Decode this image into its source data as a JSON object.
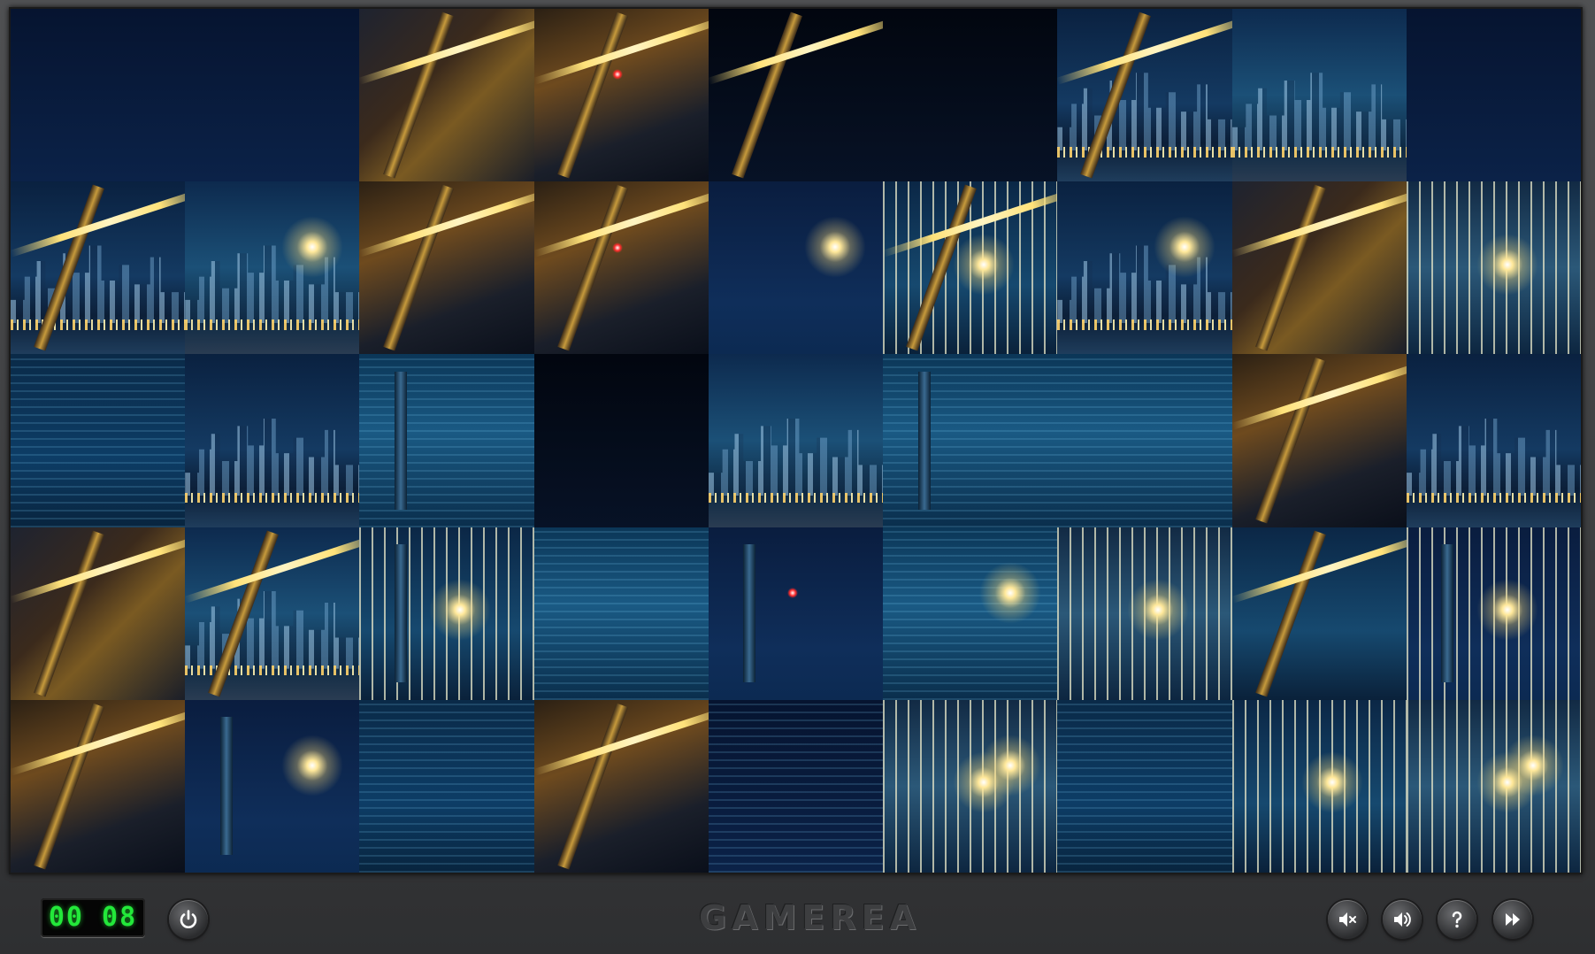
{
  "game": {
    "timer": "00 08",
    "logo": "GAMEREA"
  },
  "controls": {
    "power_icon": "power-icon",
    "mute_icon": "mute-icon",
    "volume_icon": "volume-icon",
    "help_icon": "help-icon",
    "skip_icon": "fast-forward-icon"
  },
  "puzzle": {
    "columns": 9,
    "rows": 5,
    "tiles": [
      "sky",
      "sky",
      "bridge-lit",
      "bridge-red",
      "bridge-dark",
      "sky-dark",
      "bridge-city",
      "city-night",
      "sky",
      "city-bridge",
      "city-lights",
      "bridge-girder",
      "bridge-red2",
      "light-star",
      "bridge-cable",
      "city-lights2",
      "bridge-yellow",
      "cable-bright",
      "water",
      "city-hills",
      "tower-water",
      "dark",
      "city-pyramid",
      "tower-water2",
      "water-reflect",
      "bridge-underside",
      "city-hills2",
      "bridge-orange",
      "bridge-city2",
      "cable-tower",
      "water2",
      "tower-red",
      "water-lights",
      "cable-bright2",
      "bridge-arc",
      "cable-tower2",
      "bridge-orange2",
      "light-tower",
      "water3",
      "bridge-angle",
      "water-dark",
      "cable-lights",
      "water4",
      "cable-blue",
      "cable-lights2"
    ]
  }
}
